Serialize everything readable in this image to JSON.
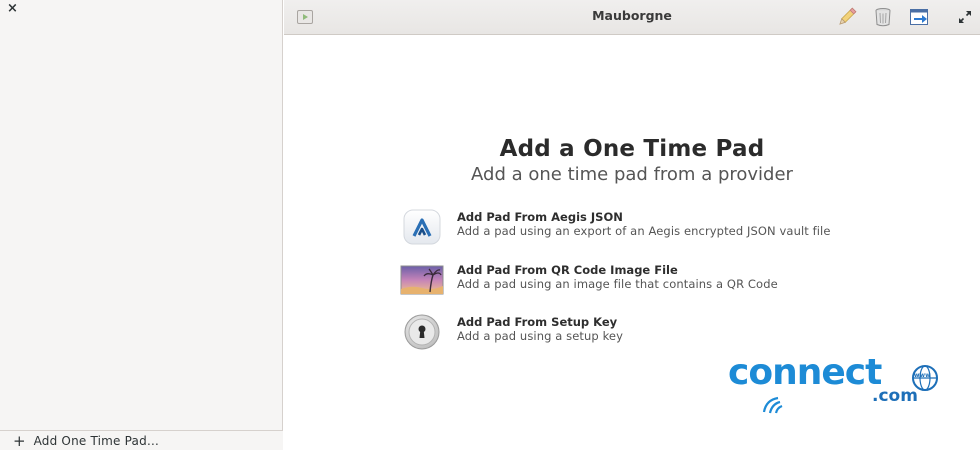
{
  "window": {
    "title": "Mauborgne"
  },
  "sidebar": {
    "close_glyph": "×",
    "footer": {
      "plus_glyph": "+",
      "label": "Add One Time Pad…"
    }
  },
  "header": {
    "icons": [
      "sidebar-toggle-icon",
      "pencil-icon",
      "trash-icon",
      "export-icon",
      "fullscreen-icon"
    ]
  },
  "main": {
    "title": "Add a One Time Pad",
    "subtitle": "Add a one time pad from a provider",
    "options": [
      {
        "icon": "aegis-icon",
        "title": "Add Pad From Aegis JSON",
        "description": "Add a pad using an export of an Aegis encrypted JSON vault file"
      },
      {
        "icon": "image-file-icon",
        "title": "Add Pad From QR Code Image File",
        "description": "Add a pad using an image file that contains a QR Code"
      },
      {
        "icon": "keyhole-icon",
        "title": "Add Pad From Setup Key",
        "description": "Add a pad using a setup key"
      }
    ]
  },
  "watermark": {
    "main": "connect",
    "sub": ".com",
    "globe_text": "www"
  },
  "colors": {
    "sidebar_bg": "#f6f5f4",
    "header_bg": "#ecebea",
    "watermark_blue": "#1d8bd6"
  }
}
